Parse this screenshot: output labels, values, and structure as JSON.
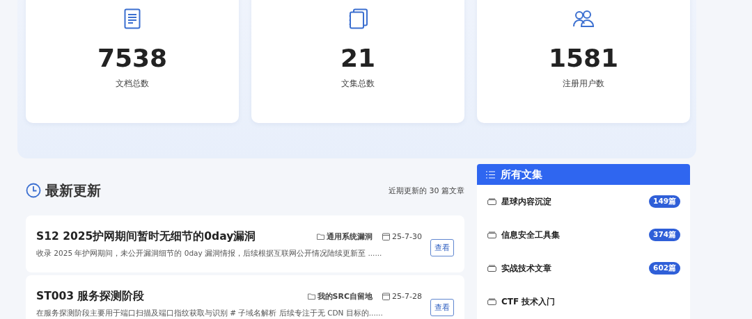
{
  "stats": [
    {
      "kind": "document",
      "value": "7538",
      "label": "文档总数"
    },
    {
      "kind": "stack",
      "value": "21",
      "label": "文集总数"
    },
    {
      "kind": "users",
      "value": "1581",
      "label": "注册用户数"
    }
  ],
  "latest": {
    "title": "最新更新",
    "note": "近期更新的 30 篇文章",
    "articles": [
      {
        "title": "S12 2025护网期间暂时无细节的0day漏洞",
        "category": "通用系统漏洞",
        "date": "25-7-30",
        "summary": "收录 2025 年护网期间，未公开漏洞细节的 0day 漏洞情报，后续根据互联网公开情况陆续更新至 ......",
        "action": "查看"
      },
      {
        "title": "ST003 服务探测阶段",
        "category": "我的SRC自留地",
        "date": "25-7-28",
        "summary": "在服务探测阶段主要用于端口扫描及端口指纹获取与识别 # 子域名解析 后续专注于无 CDN 目标的......",
        "action": "查看"
      }
    ]
  },
  "collections": {
    "title": "所有文集",
    "items": [
      {
        "name": "星球内容沉淀",
        "count": "149篇"
      },
      {
        "name": "信息安全工具集",
        "count": "374篇"
      },
      {
        "name": "实战技术文章",
        "count": "602篇"
      },
      {
        "name": "CTF 技术入门"
      }
    ]
  }
}
